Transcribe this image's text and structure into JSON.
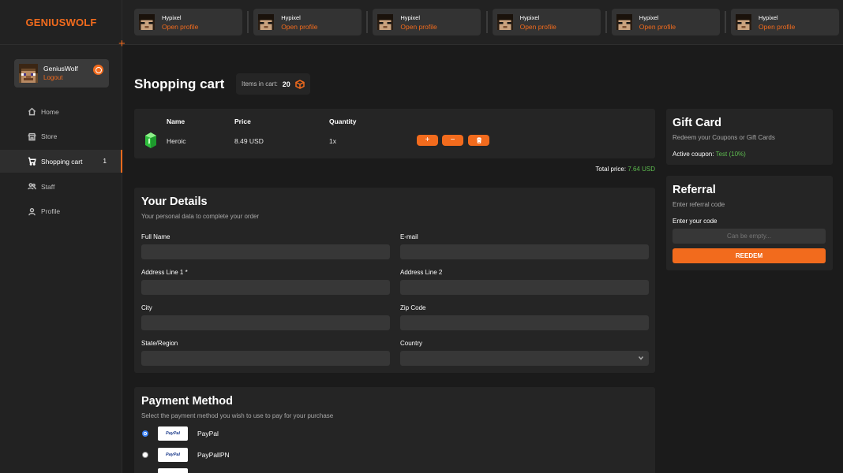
{
  "brand": {
    "logo": "GENIUSWOLF",
    "accent": "#f26b1d"
  },
  "user": {
    "name": "GeniusWolf",
    "logout": "Logout"
  },
  "nav": {
    "items": [
      {
        "label": "Home",
        "icon": "home-icon"
      },
      {
        "label": "Store",
        "icon": "store-icon"
      },
      {
        "label": "Shopping cart",
        "icon": "cart-icon",
        "count": "1",
        "active": true
      },
      {
        "label": "Staff",
        "icon": "users-icon"
      },
      {
        "label": "Profile",
        "icon": "user-icon"
      }
    ]
  },
  "servers": [
    {
      "name": "Hypixel",
      "link": "Open profile"
    },
    {
      "name": "Hypixel",
      "link": "Open profile"
    },
    {
      "name": "Hypixel",
      "link": "Open profile"
    },
    {
      "name": "Hypixel",
      "link": "Open profile"
    },
    {
      "name": "Hypixel",
      "link": "Open profile"
    },
    {
      "name": "Hypixel",
      "link": "Open profile"
    }
  ],
  "cart": {
    "title": "Shopping cart",
    "items_label": "Items in cart:",
    "items_count": "20",
    "columns": {
      "name": "Name",
      "price": "Price",
      "quantity": "Quantity"
    },
    "rows": [
      {
        "name": "Heroic",
        "price": "8.49 USD",
        "quantity": "1x"
      }
    ],
    "add_label": "+",
    "remove_label": "−",
    "total_label": "Total price:",
    "total_value": "7.64 USD",
    "total_color": "#5dbb4f"
  },
  "details": {
    "title": "Your Details",
    "subtitle": "Your personal data to complete your order",
    "fields": {
      "full_name": "Full Name",
      "email": "E-mail",
      "address1": "Address Line 1 *",
      "address2": "Address Line 2",
      "city": "City",
      "zip": "Zip Code",
      "state": "State/Region",
      "country": "Country"
    }
  },
  "payment": {
    "title": "Payment Method",
    "subtitle": "Select the payment method you wish to use to pay for your purchase",
    "logo_text": "PayPal",
    "methods": [
      {
        "name": "PayPal",
        "selected": true
      },
      {
        "name": "PayPallPN",
        "selected": false
      }
    ]
  },
  "gift": {
    "title": "Gift Card",
    "subtitle": "Redeem your Coupons or Gift Cards",
    "coupon_label": "Active coupon:",
    "coupon_value": "Test (10%)"
  },
  "referral": {
    "title": "Referral",
    "subtitle": "Enter referral code",
    "input_label": "Enter your code",
    "placeholder": "Can be empty...",
    "button": "REEDEM"
  }
}
